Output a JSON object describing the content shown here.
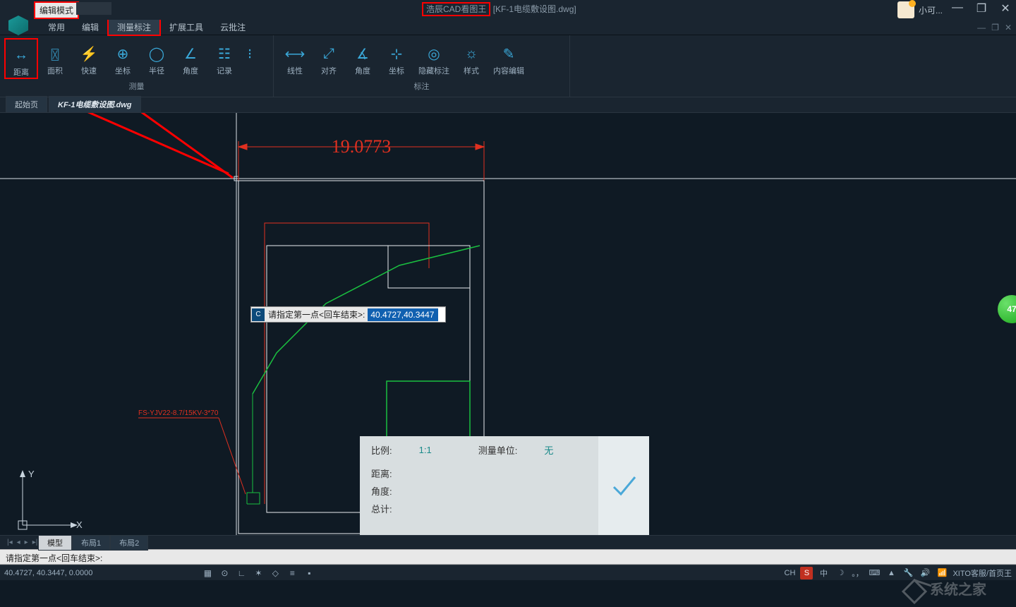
{
  "titlebar": {
    "edit_mode": "编辑模式",
    "app_name": "浩辰CAD看图王",
    "file_name": "[KF-1电缆敷设图.dwg]",
    "user_name": "小可..."
  },
  "menu": {
    "items": [
      "常用",
      "编辑",
      "测量标注",
      "扩展工具",
      "云批注"
    ],
    "active_index": 2
  },
  "ribbon": {
    "group1": {
      "label": "测量",
      "buttons": [
        "距离",
        "面积",
        "快速",
        "坐标",
        "半径",
        "角度",
        "记录"
      ]
    },
    "group2": {
      "label": "标注",
      "buttons": [
        "线性",
        "对齐",
        "角度",
        "坐标",
        "隐藏标注",
        "样式",
        "内容编辑"
      ]
    }
  },
  "file_tabs": {
    "items": [
      "起始页",
      "KF-1电缆敷设图.dwg"
    ],
    "active_index": 1
  },
  "canvas": {
    "dimension_value": "19.0773",
    "cable_label": "FS-YJV22-8.7/15KV-3*70",
    "dyn_prompt": "请指定第一点<回车结束>:",
    "dyn_value": "40.4727,40.3447"
  },
  "measure_panel": {
    "ratio_label": "比例:",
    "ratio_value": "1:1",
    "unit_label": "测量单位:",
    "unit_value": "无",
    "distance_label": "距离:",
    "angle_label": "角度:",
    "total_label": "总计:"
  },
  "float_badge": "47",
  "ucs": {
    "x": "X",
    "y": "Y"
  },
  "layout_tabs": {
    "items": [
      "模型",
      "布局1",
      "布局2"
    ],
    "active_index": 0
  },
  "command_line": "请指定第一点<回车结束>:",
  "status": {
    "coords": "40.4727, 40.3447, 0.0000",
    "ime_lang": "CH",
    "ime_s": "S",
    "ime_chn": "中",
    "ime_punct": "。，",
    "tray_text": "XITO客服/首页王"
  }
}
